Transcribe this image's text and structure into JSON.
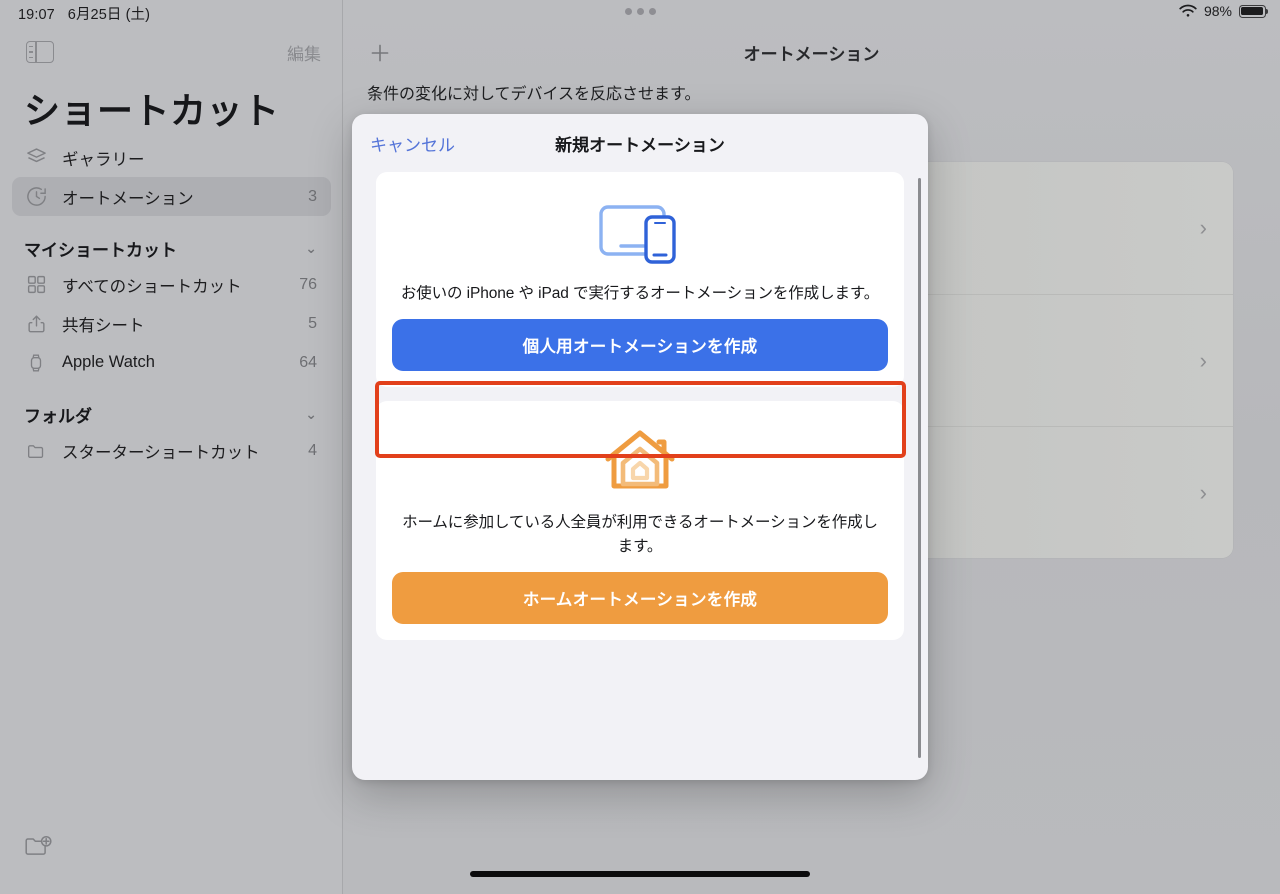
{
  "status_bar": {
    "time": "19:07",
    "date": "6月25日 (土)",
    "battery_percent": "98%",
    "wifi_icon": "wifi-icon",
    "battery_icon": "battery-icon",
    "multitask_handle_icon": "multitasking-handle-icon"
  },
  "sidebar": {
    "app_title": "ショートカット",
    "edit_label": "編集",
    "toggle_icon": "sidebar-toggle-icon",
    "new_folder_icon": "new-folder-icon",
    "items": [
      {
        "label": "ギャラリー",
        "count": "",
        "icon": "gallery-icon",
        "selected": false
      },
      {
        "label": "オートメーション",
        "count": "3",
        "icon": "automation-clock-icon",
        "selected": true
      }
    ],
    "groups": [
      {
        "title": "マイショートカット",
        "chevron": "⌄",
        "items": [
          {
            "label": "すべてのショートカット",
            "count": "76",
            "icon": "grid-icon"
          },
          {
            "label": "共有シート",
            "count": "5",
            "icon": "share-icon"
          },
          {
            "label": "Apple Watch",
            "count": "64",
            "icon": "watch-icon"
          }
        ]
      },
      {
        "title": "フォルダ",
        "chevron": "⌄",
        "items": [
          {
            "label": "スターターショートカット",
            "count": "4",
            "icon": "folder-icon"
          }
        ]
      }
    ]
  },
  "main": {
    "add_icon": "plus-icon",
    "title": "オートメーション",
    "subtitle": "条件の変化に対してデバイスを反応させます。",
    "rows": [
      {
        "chevron": "›"
      },
      {
        "chevron": "›"
      },
      {
        "chevron": "›"
      }
    ]
  },
  "modal": {
    "cancel_label": "キャンセル",
    "heading": "新規オートメーション",
    "cards": [
      {
        "art_icon": "ipad-iphone-icon",
        "description": "お使いの iPhone や iPad で実行するオートメーションを作成します。",
        "button_label": "個人用オートメーションを作成",
        "button_color": "#3b71e8",
        "highlighted": true
      },
      {
        "art_icon": "home-house-icon",
        "description": "ホームに参加している人全員が利用できるオートメーションを作成します。",
        "button_label": "ホームオートメーションを作成",
        "button_color": "#ef9c40",
        "highlighted": false
      }
    ],
    "scrollbar": "modal-scrollbar"
  },
  "annotation": {
    "highlight_color": "#e2401b",
    "target": "個人用オートメーションを作成"
  }
}
